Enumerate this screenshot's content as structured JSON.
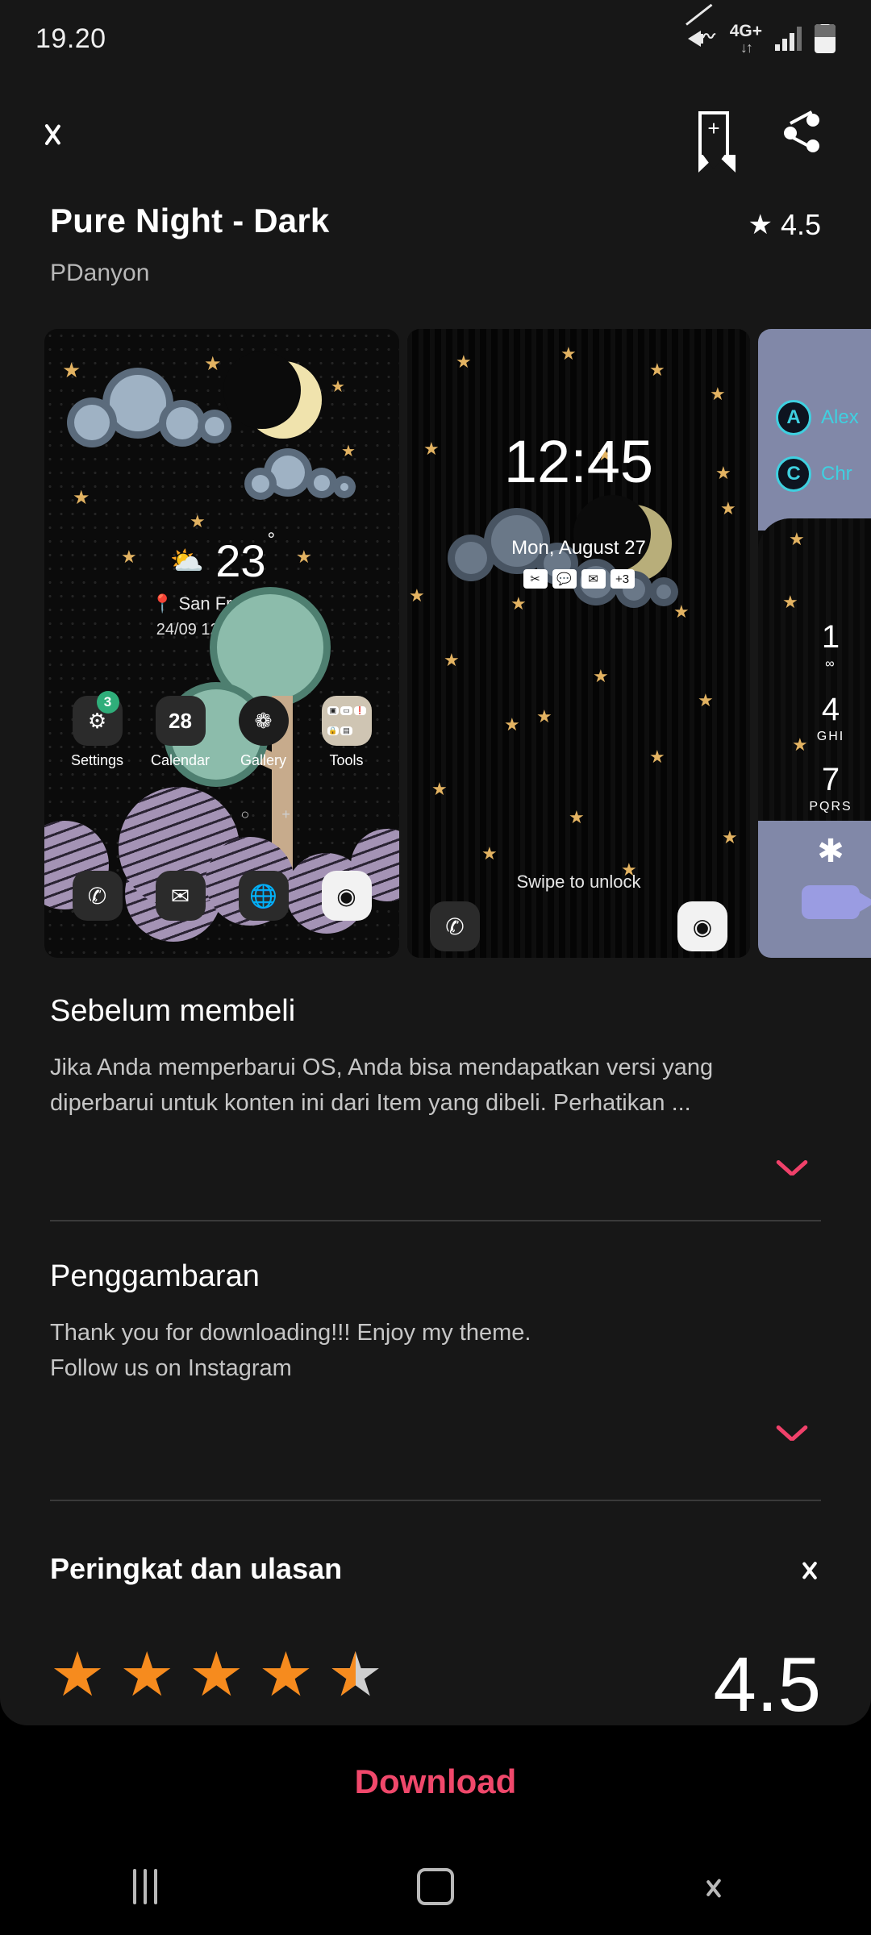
{
  "status_bar": {
    "time": "19.20",
    "network_label": "4G+",
    "network_arrows": "↓↑",
    "icons": [
      "mute-vibrate-icon",
      "network-4g-plus-icon",
      "signal-bars-icon",
      "battery-icon"
    ]
  },
  "action_bar": {
    "back_icon": "chevron-left-icon",
    "bookmark_icon": "bookmark-add-icon",
    "share_icon": "share-icon"
  },
  "header": {
    "title": "Pure Night - Dark",
    "author": "PDanyon",
    "rating_star": "★",
    "rating_value": "4.5"
  },
  "previews": {
    "card1": {
      "weather": {
        "icon": "partly-cloudy-icon",
        "temperature": "23",
        "degree": "°",
        "location_pin": "⚲",
        "location": "San Francisco",
        "date_time": "24/09 12:45 AM",
        "refresh": "↻"
      },
      "apps": [
        {
          "name": "Settings",
          "glyph": "⚙",
          "badge": "3"
        },
        {
          "name": "Calendar",
          "glyph": "28",
          "badge": ""
        },
        {
          "name": "Gallery",
          "glyph": "✿",
          "badge": ""
        },
        {
          "name": "Tools",
          "glyph": "",
          "badge": ""
        }
      ],
      "tools_tiles": [
        "▣",
        "▭",
        "❗",
        "🔒",
        "📱",
        ""
      ],
      "dock": [
        {
          "name": "phone-icon",
          "glyph": "✆"
        },
        {
          "name": "messages-icon",
          "glyph": "✉"
        },
        {
          "name": "browser-icon",
          "glyph": "🌐"
        },
        {
          "name": "camera-icon",
          "glyph": "◉"
        }
      ],
      "page_indicators": [
        "≡",
        "▲",
        "○",
        "+"
      ]
    },
    "card2": {
      "time": "12:45",
      "date": "Mon, August 27",
      "notifications": [
        "✂",
        "💬",
        "✉",
        "+3"
      ],
      "swipe_hint": "Swipe to unlock",
      "dock": [
        {
          "name": "phone-icon",
          "glyph": "✆"
        },
        {
          "name": "camera-icon",
          "glyph": "◉"
        }
      ]
    },
    "card3": {
      "contacts": [
        {
          "initial": "A",
          "name": "Alex"
        },
        {
          "initial": "C",
          "name": "Chr"
        }
      ],
      "keys": [
        {
          "digit": "1",
          "letters": "∞"
        },
        {
          "digit": "4",
          "letters": "GHI"
        },
        {
          "digit": "7",
          "letters": "PQRS"
        },
        {
          "digit": "✱",
          "letters": ""
        }
      ],
      "video_button": "video-call-icon"
    }
  },
  "sections": [
    {
      "heading": "Sebelum membeli",
      "body": "Jika Anda memperbarui OS, Anda bisa mendapatkan versi yang diperbarui untuk konten ini dari Item yang dibeli. Perhatikan ...",
      "expand_icon": "chevron-down-icon"
    },
    {
      "heading": "Penggambaran",
      "body": "Thank you for downloading!!! Enjoy my theme.\nFollow us on Instagram",
      "expand_icon": "chevron-down-icon"
    }
  ],
  "reviews": {
    "heading": "Peringkat dan ulasan",
    "chevron_icon": "chevron-right-icon",
    "stars": [
      "full",
      "full",
      "full",
      "full",
      "half"
    ],
    "score": "4.5"
  },
  "footer": {
    "download_label": "Download",
    "download_color": "#F0486B"
  },
  "nav_bar": {
    "recent_icon": "recent-apps-icon",
    "home_icon": "home-icon",
    "back_icon": "back-icon"
  }
}
